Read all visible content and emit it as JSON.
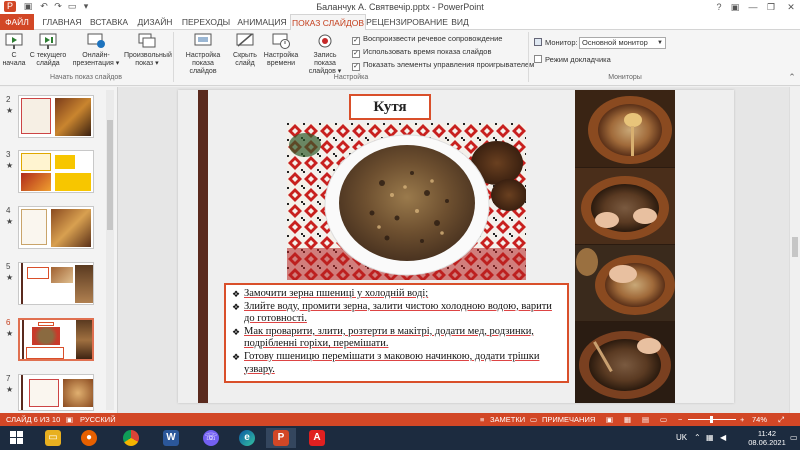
{
  "window": {
    "title": "Баланчук А. Святвечір.pptx - PowerPoint",
    "help": "?",
    "min": "—",
    "max": "❐",
    "close": "✕"
  },
  "tabs": [
    "ФАЙЛ",
    "ГЛАВНАЯ",
    "ВСТАВКА",
    "ДИЗАЙН",
    "ПЕРЕХОДЫ",
    "АНИМАЦИЯ",
    "ПОКАЗ СЛАЙДОВ",
    "РЕЦЕНЗИРОВАНИЕ",
    "ВИД"
  ],
  "ribbon": {
    "btn_from_start": "С начала",
    "btn_from_current": "С текущего слайда",
    "btn_online": "Онлайн-презентация ▾",
    "btn_custom": "Произвольный показ ▾",
    "group_start": "Начать показ слайдов",
    "btn_setup": "Настройка показа слайдов",
    "btn_hide": "Скрыть слайд",
    "btn_rehearse": "Настройка времени",
    "btn_record": "Запись показа слайдов ▾",
    "chk_narration": "Воспроизвести речевое сопровождение",
    "chk_timings": "Использовать время показа слайдов",
    "chk_controls": "Показать элементы управления проигрывателем",
    "group_setup": "Настройка",
    "monitor_label": "Монитор:",
    "monitor_value": "Основной монитор",
    "chk_presenter": "Режим докладчика",
    "group_monitors": "Мониторы"
  },
  "thumbnails": [
    {
      "num": "2",
      "star": "★"
    },
    {
      "num": "3",
      "star": "★"
    },
    {
      "num": "4",
      "star": "★"
    },
    {
      "num": "5",
      "star": "★"
    },
    {
      "num": "6",
      "star": "★"
    },
    {
      "num": "7",
      "star": "★"
    }
  ],
  "slide": {
    "title": "Кутя",
    "bullets": [
      "Замочити зерна пшениці у холодній воді;",
      "Злийте воду, промити зерна, залити чистою холодною водою, варити до готовності.",
      "Мак проварити, злити, розтерти в макітрі, додати мед, родзинки, подрібленні горіхи, перемішати.",
      "Готову пшеницю перемішати з маковою начинкою, додати трішки узвару."
    ],
    "bullet_mark": "❖"
  },
  "status": {
    "slide_counter": "СЛАЙД 6 ИЗ 10",
    "language": "РУССКИЙ",
    "notes": "ЗАМЕТКИ",
    "comments": "ПРИМЕЧАНИЯ",
    "zoom": "74%"
  },
  "taskbar": {
    "lang": "UK",
    "time": "11:42",
    "date": "08.06.2021"
  }
}
